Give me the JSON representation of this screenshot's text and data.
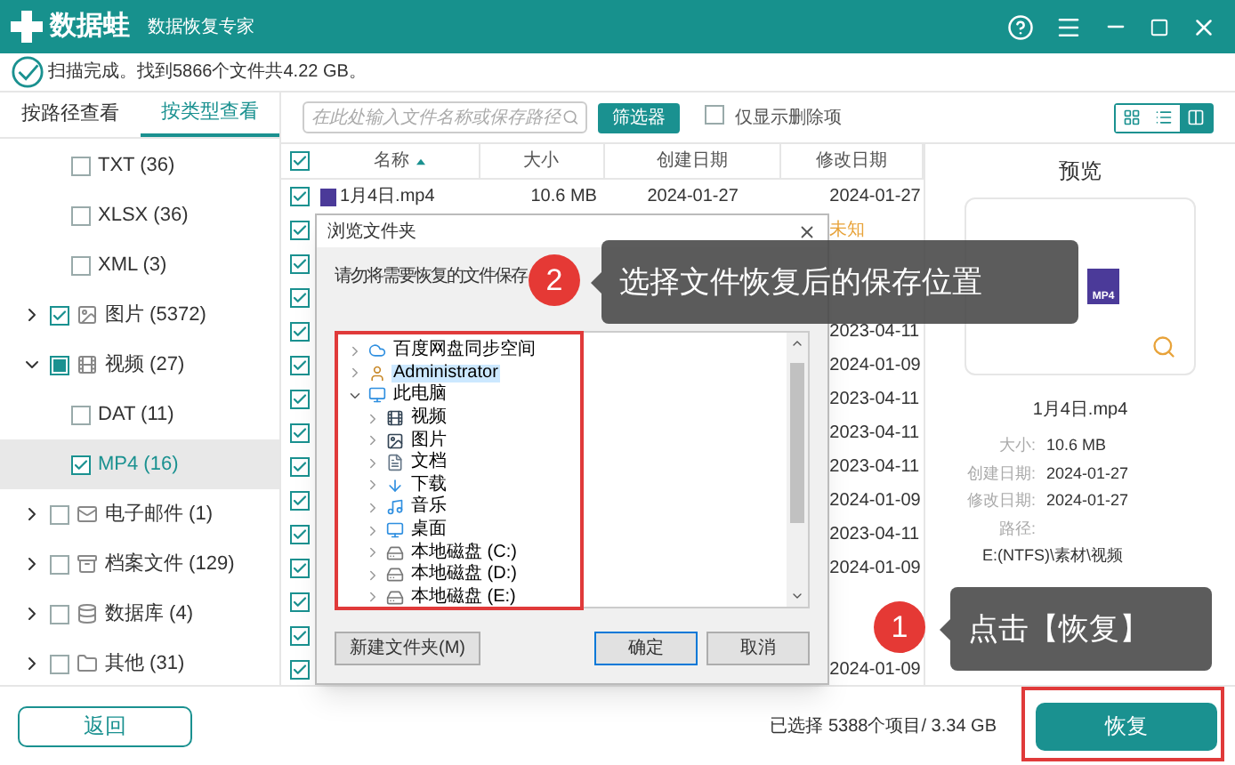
{
  "header": {
    "logo": "数据蛙",
    "subtitle": "数据恢复专家"
  },
  "scan_status": "扫描完成。找到5866个文件共4.22 GB。",
  "view_tabs": [
    {
      "label": "按路径查看",
      "selected": false
    },
    {
      "label": "按类型查看",
      "selected": true
    }
  ],
  "tree": [
    {
      "children": [
        {
          "label": "TXT (36)",
          "checked": false,
          "selected": false
        },
        {
          "label": "XLSX (36)",
          "checked": false,
          "selected": false
        },
        {
          "label": "XML (3)",
          "checked": false,
          "selected": false
        }
      ]
    },
    {
      "label": "图片 (5372)",
      "kind": "image",
      "expanded": false,
      "checked": true
    },
    {
      "label": "视频 (27)",
      "kind": "video",
      "expanded": true,
      "partial": true,
      "children": [
        {
          "label": "DAT (11)",
          "checked": false,
          "selected": false
        },
        {
          "label": "MP4 (16)",
          "checked": true,
          "selected": true
        }
      ]
    },
    {
      "label": "电子邮件 (1)",
      "kind": "email",
      "expanded": false,
      "checked": false
    },
    {
      "label": "档案文件 (129)",
      "kind": "archive",
      "expanded": false,
      "checked": false
    },
    {
      "label": "数据库 (4)",
      "kind": "database",
      "expanded": false,
      "checked": false
    },
    {
      "label": "其他 (31)",
      "kind": "folder",
      "expanded": false,
      "checked": false
    }
  ],
  "search": {
    "placeholder": "在此处输入文件名称或保存路径"
  },
  "filter_button": "筛选器",
  "deleted_only": {
    "label": "仅显示删除项",
    "checked": false
  },
  "view_modes": [
    {
      "kind": "grid",
      "selected": false
    },
    {
      "kind": "list",
      "selected": false
    },
    {
      "kind": "preview",
      "selected": true
    }
  ],
  "table": {
    "all_checked": true,
    "columns": [
      "名称",
      "大小",
      "创建日期",
      "修改日期"
    ],
    "rows": [
      {
        "checked": true,
        "name": "1月4日.mp4",
        "size": "10.6 MB",
        "created": "2024-01-27",
        "modified": "2024-01-27",
        "modified_unknown": false
      },
      {
        "checked": true,
        "modified": "未知",
        "modified_unknown": true
      },
      {
        "checked": true
      },
      {
        "checked": true
      },
      {
        "checked": true,
        "modified": "2023-04-11",
        "modified_unknown": false
      },
      {
        "checked": true,
        "modified": "2024-01-09",
        "modified_unknown": false
      },
      {
        "checked": true,
        "modified": "2023-04-11",
        "modified_unknown": false
      },
      {
        "checked": true,
        "modified": "2023-04-11",
        "modified_unknown": false
      },
      {
        "checked": true,
        "modified": "2023-04-11",
        "modified_unknown": false
      },
      {
        "checked": true,
        "modified": "2024-01-09",
        "modified_unknown": false
      },
      {
        "checked": true,
        "modified": "2023-04-11",
        "modified_unknown": false
      },
      {
        "checked": true,
        "modified": "2024-01-09",
        "modified_unknown": false
      },
      {
        "checked": true
      },
      {
        "checked": true
      },
      {
        "checked": true,
        "modified": "2024-01-09",
        "modified_unknown": false
      }
    ]
  },
  "preview": {
    "title": "预览",
    "file_type": "MP4",
    "file_name": "1月4日.mp4",
    "details": [
      {
        "label": "大小:",
        "value": "10.6 MB"
      },
      {
        "label": "创建日期:",
        "value": "2024-01-27"
      },
      {
        "label": "修改日期:",
        "value": "2024-01-27"
      },
      {
        "label": "路径:"
      }
    ],
    "path": "E:(NTFS)\\素材\\视频"
  },
  "dialog": {
    "title": "浏览文件夹",
    "message": "请勿将需要恢复的文件保存",
    "folders": [
      {
        "label": "百度网盘同步空间",
        "kind": "cloud",
        "expanded": false,
        "selected": false
      },
      {
        "label": "Administrator",
        "kind": "user",
        "expanded": false,
        "selected": true
      },
      {
        "label": "此电脑",
        "kind": "pc",
        "expanded": true,
        "selected": false,
        "children": [
          {
            "label": "视频",
            "kind": "video",
            "expanded": false,
            "selected": false
          },
          {
            "label": "图片",
            "kind": "image",
            "expanded": false,
            "selected": false
          },
          {
            "label": "文档",
            "kind": "document",
            "expanded": false,
            "selected": false
          },
          {
            "label": "下载",
            "kind": "download",
            "expanded": false,
            "selected": false
          },
          {
            "label": "音乐",
            "kind": "music",
            "expanded": false,
            "selected": false
          },
          {
            "label": "桌面",
            "kind": "desktop",
            "expanded": false,
            "selected": false
          },
          {
            "label": "本地磁盘 (C:)",
            "kind": "drive",
            "expanded": false,
            "selected": false
          },
          {
            "label": "本地磁盘 (D:)",
            "kind": "drive",
            "expanded": false,
            "selected": false
          },
          {
            "label": "本地磁盘 (E:)",
            "kind": "drive",
            "expanded": false,
            "selected": false
          }
        ]
      }
    ],
    "buttons": [
      {
        "label": "新建文件夹(M)",
        "default": false
      },
      {
        "label": "确定",
        "default": true
      },
      {
        "label": "取消",
        "default": false
      }
    ]
  },
  "callouts": [
    {
      "number": "2",
      "text": "选择文件恢复后的保存位置"
    },
    {
      "number": "1",
      "text": "点击【恢复】"
    }
  ],
  "footer": {
    "back": "返回",
    "selection": "已选择 5388个项目/ 3.34 GB",
    "recover": "恢复"
  }
}
